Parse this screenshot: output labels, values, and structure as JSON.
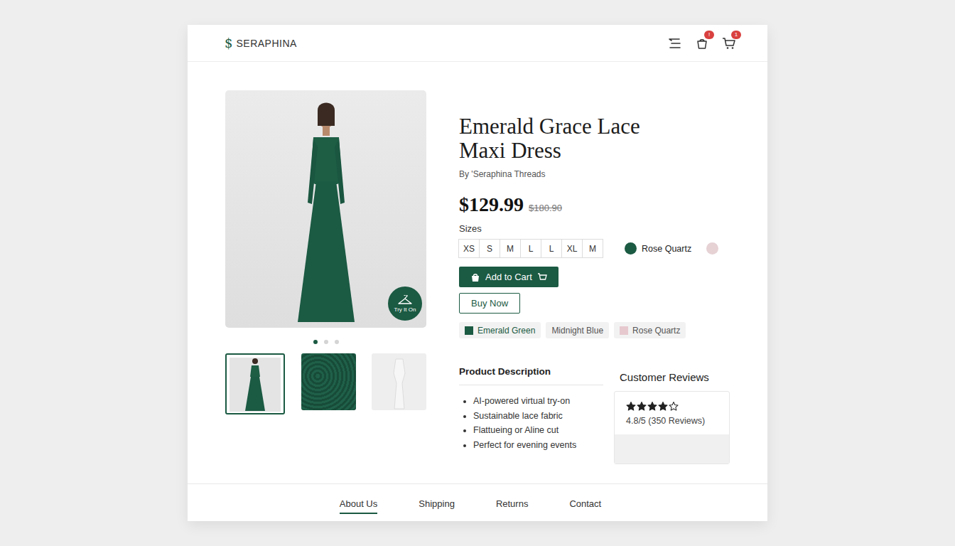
{
  "brand": {
    "mark": "$",
    "name": "SERAPHINA"
  },
  "header": {
    "bag_badge": "!",
    "cart_badge": "1"
  },
  "gallery": {
    "try_on_label": "Try It On",
    "dots": [
      {
        "selected": true
      },
      {
        "selected": false
      },
      {
        "selected": false
      }
    ],
    "thumbnails": [
      {
        "selected": true
      },
      {
        "selected": false
      },
      {
        "selected": false
      }
    ]
  },
  "product": {
    "title": "Emerald Grace Lace Maxi Dress",
    "byline": "By 'Seraphina Threads",
    "price": "$129.99",
    "old_price": "$180.90"
  },
  "sizes": {
    "label": "Sizes",
    "options": [
      {
        "label": "XS",
        "selected": false
      },
      {
        "label": "S",
        "selected": false
      },
      {
        "label": "M",
        "selected": false
      },
      {
        "label": "L",
        "selected": false
      },
      {
        "label": "L",
        "selected": false
      },
      {
        "label": "XL",
        "selected": false
      },
      {
        "label": "M",
        "selected": false
      }
    ]
  },
  "color_picker": {
    "label": "Rose Quartz",
    "swatches": [
      {
        "color": "#1b5a43"
      },
      {
        "color": "#e6d1d5"
      }
    ]
  },
  "buttons": {
    "add_to_cart": "Add to Cart",
    "buy_now": "Buy Now"
  },
  "color_chips": [
    {
      "label": "Emerald Green",
      "selected": true,
      "color": "#1b5a43"
    },
    {
      "label": "Midnight Blue",
      "selected": false
    },
    {
      "label": "Rose Quartz",
      "selected": false,
      "color": "#e6c9cf"
    }
  ],
  "description": {
    "title": "Product Description",
    "bullets": [
      "AI-powered virtual try-on",
      "Sustainable lace fabric",
      "Flattueing or Aline cut",
      "Perfect for evening events"
    ]
  },
  "reviews": {
    "title": "Customer Reviews",
    "stars": 4,
    "max_stars": 5,
    "rating": "4.8/5 (350 Reviews)"
  },
  "footer": {
    "links": [
      {
        "label": "About Us",
        "selected": true
      },
      {
        "label": "Shipping",
        "selected": false
      },
      {
        "label": "Returns",
        "selected": false
      },
      {
        "label": "Contact",
        "selected": false
      }
    ]
  }
}
